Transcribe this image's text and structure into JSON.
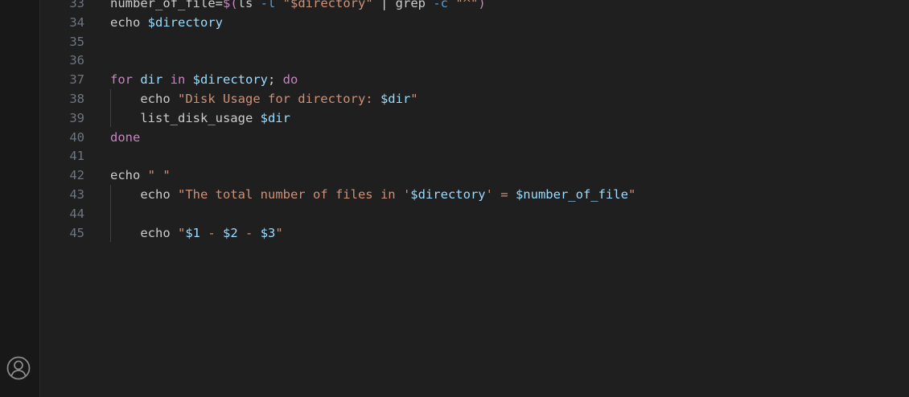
{
  "editor": {
    "lines": [
      {
        "number": "33",
        "tokens": [
          {
            "t": "number_of_file",
            "c": "id"
          },
          {
            "t": "=",
            "c": "op"
          },
          {
            "t": "$(",
            "c": "kw"
          },
          {
            "t": "ls ",
            "c": "id"
          },
          {
            "t": "-l ",
            "c": "flag"
          },
          {
            "t": "\"$directory\"",
            "c": "str"
          },
          {
            "t": " | ",
            "c": "op"
          },
          {
            "t": "grep ",
            "c": "id"
          },
          {
            "t": "-c ",
            "c": "flag"
          },
          {
            "t": "\"^\"",
            "c": "str"
          },
          {
            "t": ")",
            "c": "kw"
          }
        ]
      },
      {
        "number": "34",
        "tokens": [
          {
            "t": "echo ",
            "c": "id"
          },
          {
            "t": "$directory",
            "c": "var"
          }
        ]
      },
      {
        "number": "35",
        "tokens": []
      },
      {
        "number": "36",
        "tokens": []
      },
      {
        "number": "37",
        "tokens": [
          {
            "t": "for ",
            "c": "kw"
          },
          {
            "t": "dir ",
            "c": "var"
          },
          {
            "t": "in ",
            "c": "kw"
          },
          {
            "t": "$directory",
            "c": "var"
          },
          {
            "t": "; ",
            "c": "op"
          },
          {
            "t": "do",
            "c": "kw"
          }
        ]
      },
      {
        "number": "38",
        "tokens": [
          {
            "t": "    echo ",
            "c": "id"
          },
          {
            "t": "\"Disk Usage for directory: ",
            "c": "str"
          },
          {
            "t": "$dir",
            "c": "var"
          },
          {
            "t": "\"",
            "c": "str"
          }
        ]
      },
      {
        "number": "39",
        "tokens": [
          {
            "t": "    list_disk_usage ",
            "c": "id"
          },
          {
            "t": "$dir",
            "c": "var"
          }
        ]
      },
      {
        "number": "40",
        "tokens": [
          {
            "t": "done",
            "c": "kw"
          }
        ]
      },
      {
        "number": "41",
        "tokens": []
      },
      {
        "number": "42",
        "tokens": [
          {
            "t": "echo ",
            "c": "id"
          },
          {
            "t": "\" \"",
            "c": "str"
          }
        ]
      },
      {
        "number": "43",
        "tokens": [
          {
            "t": "    echo ",
            "c": "id"
          },
          {
            "t": "\"The total number of files in '",
            "c": "str"
          },
          {
            "t": "$directory",
            "c": "var"
          },
          {
            "t": "' = ",
            "c": "str"
          },
          {
            "t": "$number_of_file",
            "c": "var"
          },
          {
            "t": "\"",
            "c": "str"
          }
        ]
      },
      {
        "number": "44",
        "tokens": []
      },
      {
        "number": "45",
        "tokens": [
          {
            "t": "    echo ",
            "c": "id"
          },
          {
            "t": "\"",
            "c": "str"
          },
          {
            "t": "$1",
            "c": "var"
          },
          {
            "t": " - ",
            "c": "str"
          },
          {
            "t": "$2",
            "c": "var"
          },
          {
            "t": " - ",
            "c": "str"
          },
          {
            "t": "$3",
            "c": "var"
          },
          {
            "t": "\"",
            "c": "str"
          }
        ]
      }
    ]
  },
  "activity_bar": {
    "account_icon": "account-icon"
  },
  "colors": {
    "background": "#1f1f1f",
    "line_number": "#6e7681",
    "keyword": "#c586c0",
    "variable": "#9cdcfe",
    "string": "#ce9178",
    "text": "#cccccc"
  }
}
